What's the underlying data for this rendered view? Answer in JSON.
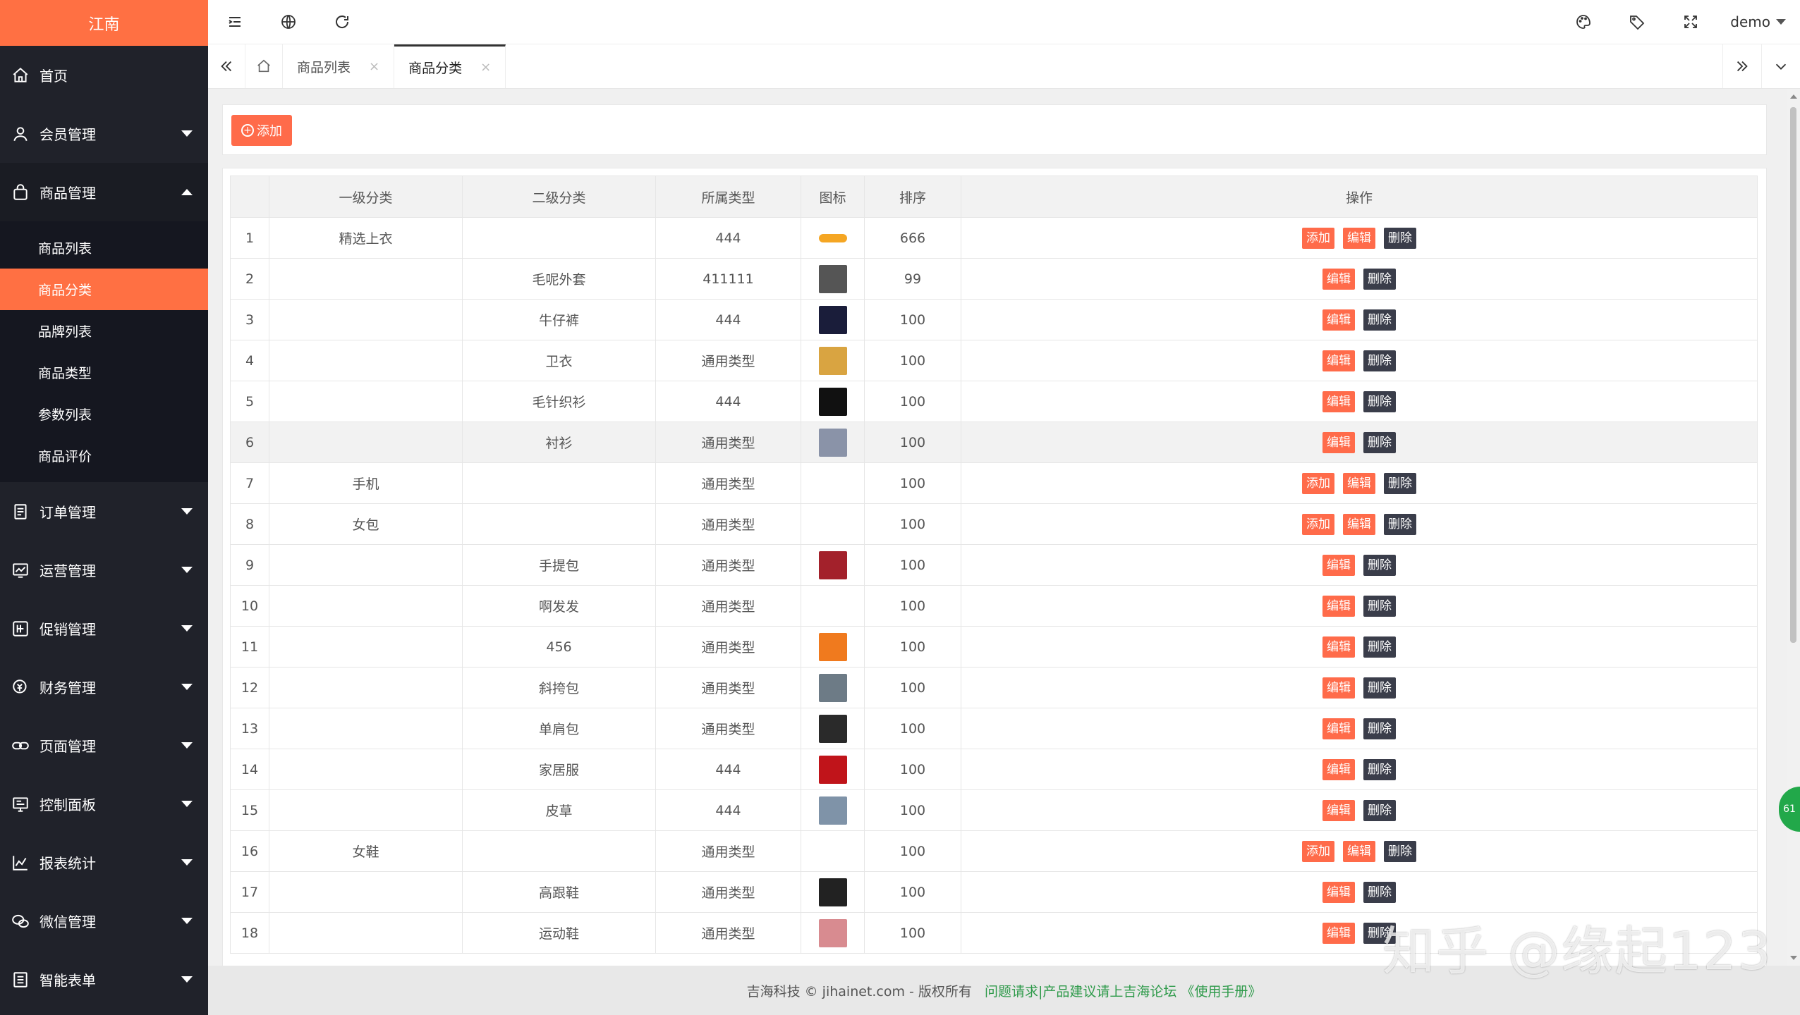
{
  "app": {
    "brand": "江南"
  },
  "sidebar": {
    "items": [
      {
        "label": "首页",
        "icon": "home-icon"
      },
      {
        "label": "会员管理",
        "icon": "user-icon"
      },
      {
        "label": "商品管理",
        "icon": "bag-icon"
      },
      {
        "label": "订单管理",
        "icon": "order-icon"
      },
      {
        "label": "运营管理",
        "icon": "chart-icon"
      },
      {
        "label": "促销管理",
        "icon": "promo-icon"
      },
      {
        "label": "财务管理",
        "icon": "finance-icon"
      },
      {
        "label": "页面管理",
        "icon": "link-icon"
      },
      {
        "label": "控制面板",
        "icon": "dashboard-icon"
      },
      {
        "label": "报表统计",
        "icon": "stats-icon"
      },
      {
        "label": "微信管理",
        "icon": "wechat-icon"
      },
      {
        "label": "智能表单",
        "icon": "form-icon"
      }
    ],
    "submenu": [
      "商品列表",
      "商品分类",
      "品牌列表",
      "商品类型",
      "参数列表",
      "商品评价"
    ]
  },
  "topbar": {
    "user": "demo"
  },
  "tabs": [
    {
      "label": "商品列表"
    },
    {
      "label": "商品分类"
    }
  ],
  "toolbar": {
    "add_label": "添加"
  },
  "table": {
    "headers": [
      "",
      "一级分类",
      "二级分类",
      "所属类型",
      "图标",
      "排序",
      "操作"
    ],
    "buttons": {
      "add": "添加",
      "edit": "编辑",
      "delete": "删除"
    },
    "rows": [
      {
        "no": "1",
        "cat1": "精选上衣",
        "cat2": "",
        "type": "444",
        "sort": "666",
        "top": true,
        "icon_color": "#f5a623"
      },
      {
        "no": "2",
        "cat1": "",
        "cat2": "毛呢外套",
        "type": "411111",
        "sort": "99",
        "top": false,
        "icon_color": "#555"
      },
      {
        "no": "3",
        "cat1": "",
        "cat2": "牛仔裤",
        "type": "444",
        "sort": "100",
        "top": false,
        "icon_color": "#1a1d3a"
      },
      {
        "no": "4",
        "cat1": "",
        "cat2": "卫衣",
        "type": "通用类型",
        "sort": "100",
        "top": false,
        "icon_color": "#d9a441"
      },
      {
        "no": "5",
        "cat1": "",
        "cat2": "毛针织衫",
        "type": "444",
        "sort": "100",
        "top": false,
        "icon_color": "#111"
      },
      {
        "no": "6",
        "cat1": "",
        "cat2": "衬衫",
        "type": "通用类型",
        "sort": "100",
        "top": false,
        "icon_color": "#8a93a8"
      },
      {
        "no": "7",
        "cat1": "手机",
        "cat2": "",
        "type": "通用类型",
        "sort": "100",
        "top": true,
        "icon_color": ""
      },
      {
        "no": "8",
        "cat1": "女包",
        "cat2": "",
        "type": "通用类型",
        "sort": "100",
        "top": true,
        "icon_color": ""
      },
      {
        "no": "9",
        "cat1": "",
        "cat2": "手提包",
        "type": "通用类型",
        "sort": "100",
        "top": false,
        "icon_color": "#a3212b"
      },
      {
        "no": "10",
        "cat1": "",
        "cat2": "啊发发",
        "type": "通用类型",
        "sort": "100",
        "top": false,
        "icon_color": ""
      },
      {
        "no": "11",
        "cat1": "",
        "cat2": "456",
        "type": "通用类型",
        "sort": "100",
        "top": false,
        "icon_color": "#f07a1e"
      },
      {
        "no": "12",
        "cat1": "",
        "cat2": "斜挎包",
        "type": "通用类型",
        "sort": "100",
        "top": false,
        "icon_color": "#6d7b86"
      },
      {
        "no": "13",
        "cat1": "",
        "cat2": "单肩包",
        "type": "通用类型",
        "sort": "100",
        "top": false,
        "icon_color": "#2a2a2a"
      },
      {
        "no": "14",
        "cat1": "",
        "cat2": "家居服",
        "type": "444",
        "sort": "100",
        "top": false,
        "icon_color": "#c0141a"
      },
      {
        "no": "15",
        "cat1": "",
        "cat2": "皮草",
        "type": "444",
        "sort": "100",
        "top": false,
        "icon_color": "#7f93a8"
      },
      {
        "no": "16",
        "cat1": "女鞋",
        "cat2": "",
        "type": "通用类型",
        "sort": "100",
        "top": true,
        "icon_color": ""
      },
      {
        "no": "17",
        "cat1": "",
        "cat2": "高跟鞋",
        "type": "通用类型",
        "sort": "100",
        "top": false,
        "icon_color": "#222"
      },
      {
        "no": "18",
        "cat1": "",
        "cat2": "运动鞋",
        "type": "通用类型",
        "sort": "100",
        "top": false,
        "icon_color": "#d88b90"
      }
    ]
  },
  "footer": {
    "copyright": "吉海科技 © jihainet.com - 版权所有",
    "links": "问题请求|产品建议请上吉海论坛 《使用手册》"
  },
  "badge": "61",
  "watermark": "知乎 @缘起123"
}
